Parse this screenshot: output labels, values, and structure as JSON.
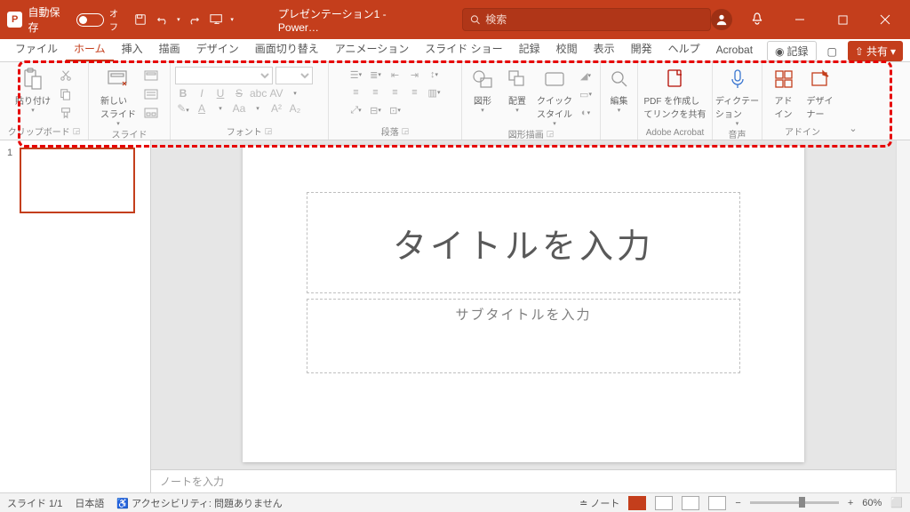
{
  "titlebar": {
    "autosave": "自動保存",
    "autosave_state": "オフ",
    "title": "プレゼンテーション1 - Power…",
    "search_placeholder": "検索"
  },
  "menu": {
    "items": [
      "ファイル",
      "ホーム",
      "挿入",
      "描画",
      "デザイン",
      "画面切り替え",
      "アニメーション",
      "スライド ショー",
      "記録",
      "校閲",
      "表示",
      "開発",
      "ヘルプ",
      "Acrobat"
    ],
    "active": 1,
    "record": "記録",
    "share": "共有"
  },
  "ribbon": {
    "clipboard": {
      "label": "クリップボード",
      "paste": "貼り付け"
    },
    "slides": {
      "label": "スライド",
      "new": "新しい\nスライド"
    },
    "font": {
      "label": "フォント",
      "bold": "B",
      "italic": "I",
      "underline": "U",
      "strike": "S",
      "shadow": "abc",
      "spacing": "AV",
      "clear": "A",
      "case": "Aa",
      "sup": "A²",
      "sub": "A₂"
    },
    "paragraph": {
      "label": "段落"
    },
    "drawing": {
      "label": "図形描画",
      "shapes": "図形",
      "arrange": "配置",
      "quick": "クイック\nスタイル"
    },
    "editing": {
      "label": "",
      "edit": "編集"
    },
    "acrobat": {
      "label": "Adobe Acrobat",
      "pdf": "PDF を作成し\nてリンクを共有"
    },
    "voice": {
      "label": "音声",
      "dictate": "ディクテー\nション"
    },
    "addins": {
      "label": "アドイン",
      "addin": "アド\nイン",
      "designer": "デザイ\nナー"
    }
  },
  "slide": {
    "title": "タイトルを入力",
    "subtitle": "サブタイトルを入力",
    "thumb": "1"
  },
  "notes": "ノートを入力",
  "status": {
    "slide": "スライド 1/1",
    "lang": "日本語",
    "a11y": "アクセシビリティ: 問題ありません",
    "notes": "ノート",
    "zoom": "60%"
  }
}
